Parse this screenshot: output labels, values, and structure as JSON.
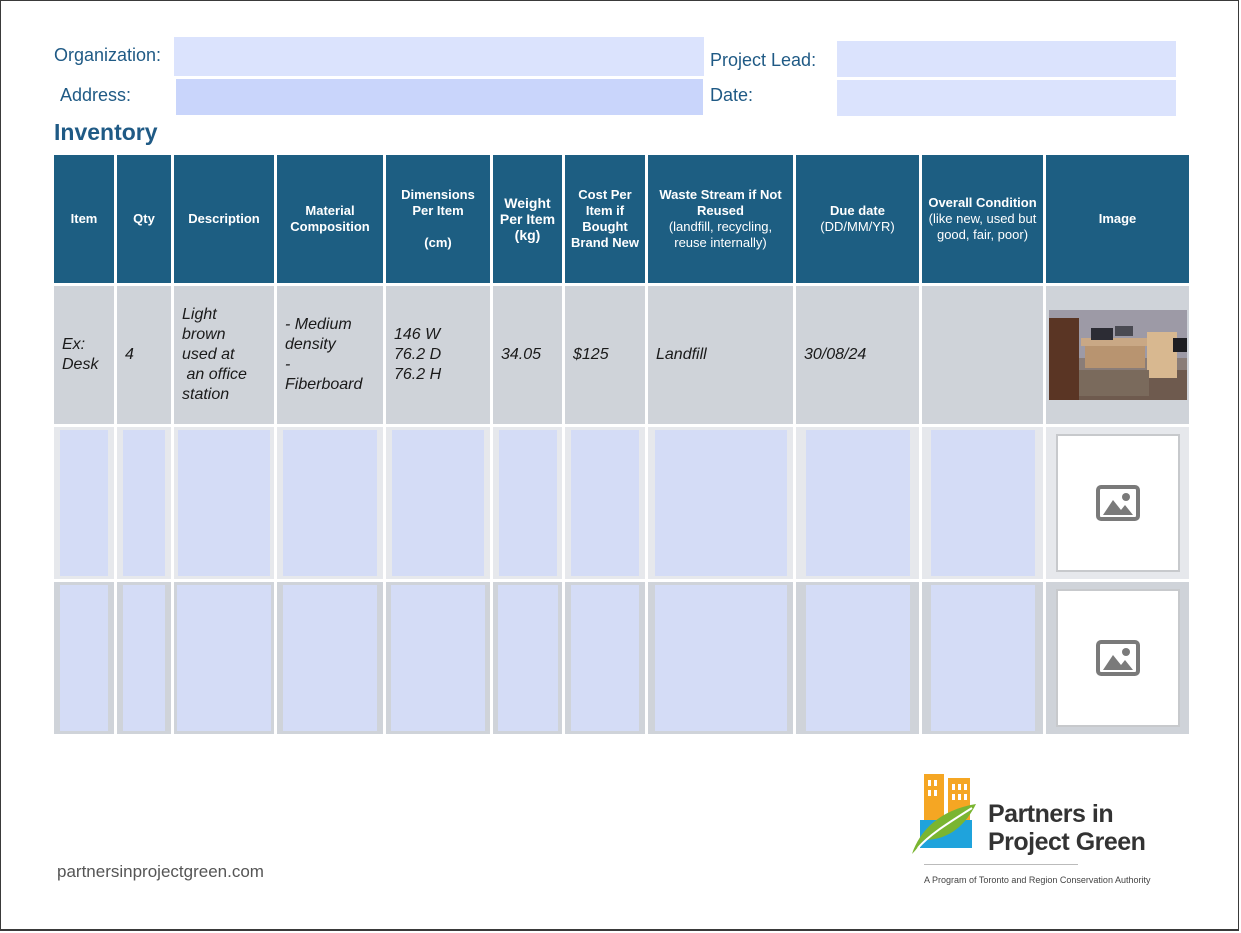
{
  "form": {
    "organization_label": "Organization:",
    "project_lead_label": "Project Lead:",
    "address_label": "Address:",
    "date_label": "Date:",
    "organization_value": "",
    "project_lead_value": "",
    "address_value": "",
    "date_value": ""
  },
  "heading": "Inventory",
  "table": {
    "headers": {
      "item": "Item",
      "qty": "Qty",
      "description": "Description",
      "material": "Material Composition",
      "dimensions": "Dimensions Per Item",
      "dimensions_unit": "(cm)",
      "weight": "Weight Per Item",
      "weight_unit": "(kg)",
      "cost": "Cost Per Item if Bought Brand New",
      "waste": "Waste Stream if Not Reused",
      "waste_sub": "(landfill, recycling, reuse internally)",
      "due": "Due date",
      "due_sub": "(DD/MM/YR)",
      "condition": "Overall Condition",
      "condition_sub": "(like new, used but good, fair, poor)",
      "image": "Image"
    },
    "example_row": {
      "item_line1": "Ex:",
      "item_line2": "Desk",
      "qty": "4",
      "description_lines": [
        "Light",
        "brown",
        "used at",
        " an office",
        "station"
      ],
      "material_lines": [
        "- Medium",
        "density",
        "-",
        "Fiberboard"
      ],
      "dimension_lines": [
        "146 W",
        "76.2 D",
        "76.2 H"
      ],
      "weight": "34.05",
      "cost": "$125",
      "waste": "Landfill",
      "due": "30/08/24",
      "condition": ""
    }
  },
  "footer": {
    "url": "partnersinprojectgreen.com",
    "brand_line1": "Partners in",
    "brand_line2": "Project Green",
    "tagline": "A Program of Toronto and Region Conservation Authority"
  },
  "icons": {
    "image_placeholder": "image-placeholder-icon"
  },
  "colors": {
    "header_bg": "#1d5e82",
    "label_text": "#1f5a85",
    "field_bg": "#dbe3fd",
    "row_gray": "#cfd3d9",
    "logo_orange": "#f5a623",
    "logo_green": "#7ab531",
    "logo_blue": "#1fa3dc"
  }
}
